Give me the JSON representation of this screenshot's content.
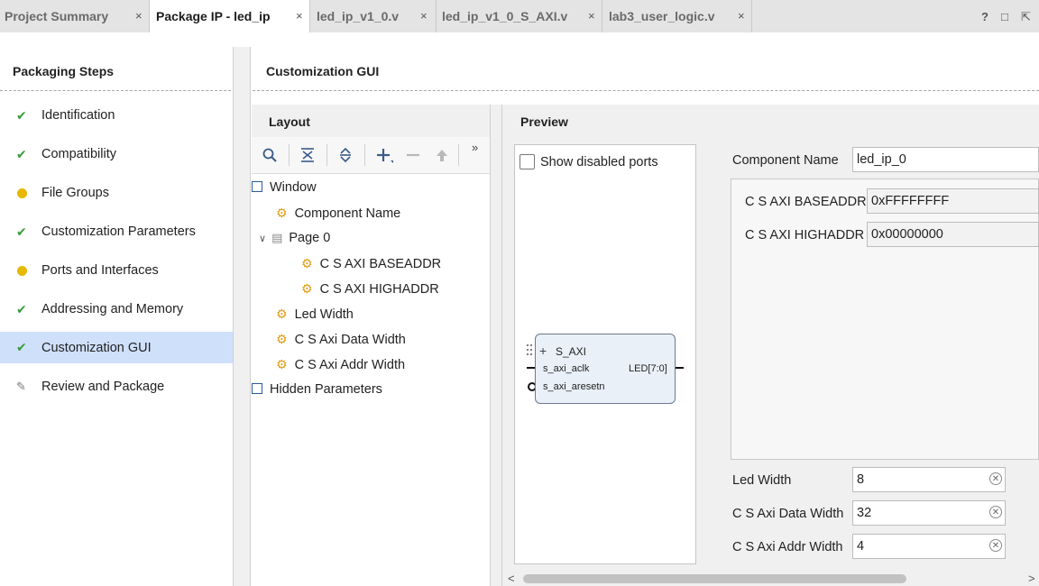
{
  "tabs": [
    {
      "label": "Project Summary",
      "close": "×",
      "active": false
    },
    {
      "label": "Package IP - led_ip",
      "close": "×",
      "active": true
    },
    {
      "label": "led_ip_v1_0.v",
      "close": "×",
      "active": false
    },
    {
      "label": "led_ip_v1_0_S_AXI.v",
      "close": "×",
      "active": false
    },
    {
      "label": "lab3_user_logic.v",
      "close": "×",
      "active": false
    }
  ],
  "window_controls": {
    "help": "?",
    "restore": "□",
    "float": "⇱"
  },
  "packaging": {
    "title": "Packaging Steps",
    "steps": [
      {
        "label": "Identification",
        "status": "check"
      },
      {
        "label": "Compatibility",
        "status": "check"
      },
      {
        "label": "File Groups",
        "status": "warning"
      },
      {
        "label": "Customization Parameters",
        "status": "check"
      },
      {
        "label": "Ports and Interfaces",
        "status": "warning"
      },
      {
        "label": "Addressing and Memory",
        "status": "check"
      },
      {
        "label": "Customization GUI",
        "status": "check",
        "selected": true
      },
      {
        "label": "Review and Package",
        "status": "edit"
      }
    ]
  },
  "customization": {
    "title": "Customization GUI",
    "layout": {
      "title": "Layout",
      "more": "»",
      "tree": [
        {
          "label": "Window",
          "kind": "group"
        },
        {
          "label": "Component Name",
          "kind": "param"
        },
        {
          "label": "Page 0",
          "kind": "page"
        },
        {
          "label": "C S AXI BASEADDR",
          "kind": "param"
        },
        {
          "label": "C S AXI HIGHADDR",
          "kind": "param"
        },
        {
          "label": "Led Width",
          "kind": "param"
        },
        {
          "label": "C S Axi Data Width",
          "kind": "param"
        },
        {
          "label": "C S Axi Addr Width",
          "kind": "param"
        },
        {
          "label": "Hidden Parameters",
          "kind": "group"
        }
      ]
    },
    "preview": {
      "title": "Preview",
      "show_disabled_ports": {
        "label": "Show disabled ports",
        "checked": false
      },
      "ip_block": {
        "bus": "S_AXI",
        "ports_left": [
          "s_axi_aclk",
          "s_axi_aresetn"
        ],
        "ports_right": [
          "LED[7:0]"
        ]
      },
      "component_name": {
        "label": "Component Name",
        "value": "led_ip_0"
      },
      "page_params": [
        {
          "label": "C S AXI BASEADDR",
          "value": "0xFFFFFFFF"
        },
        {
          "label": "C S AXI HIGHADDR",
          "value": "0x00000000"
        }
      ],
      "params": [
        {
          "label": "Led Width",
          "value": "8"
        },
        {
          "label": "C S Axi Data Width",
          "value": "32"
        },
        {
          "label": "C S Axi Addr Width",
          "value": "4"
        }
      ]
    }
  }
}
